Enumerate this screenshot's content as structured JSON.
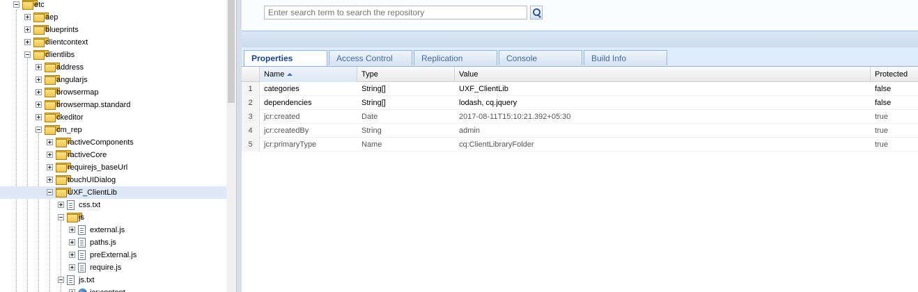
{
  "tree": {
    "items": [
      {
        "label": "etc",
        "type": "folder",
        "toggle": "minus"
      },
      {
        "label": "aep",
        "type": "folder",
        "toggle": "plus"
      },
      {
        "label": "blueprints",
        "type": "folder",
        "toggle": "plus"
      },
      {
        "label": "clientcontext",
        "type": "folder",
        "toggle": "plus"
      },
      {
        "label": "clientlibs",
        "type": "folder",
        "toggle": "minus"
      },
      {
        "label": "address",
        "type": "folder",
        "toggle": "plus"
      },
      {
        "label": "angularjs",
        "type": "folder",
        "toggle": "plus"
      },
      {
        "label": "browsermap",
        "type": "folder",
        "toggle": "plus"
      },
      {
        "label": "browsermap.standard",
        "type": "folder",
        "toggle": "plus"
      },
      {
        "label": "ckeditor",
        "type": "folder",
        "toggle": "plus"
      },
      {
        "label": "cm_rep",
        "type": "folder",
        "toggle": "minus"
      },
      {
        "label": "ractiveComponents",
        "type": "folder",
        "toggle": "plus"
      },
      {
        "label": "ractiveCore",
        "type": "folder",
        "toggle": "plus"
      },
      {
        "label": "requirejs_baseUrl",
        "type": "folder",
        "toggle": "plus"
      },
      {
        "label": "touchUIDialog",
        "type": "folder",
        "toggle": "plus"
      },
      {
        "label": "UXF_ClientLib",
        "type": "folder",
        "toggle": "minus",
        "selected": true
      },
      {
        "label": "css.txt",
        "type": "file",
        "toggle": "plus"
      },
      {
        "label": "js",
        "type": "folder",
        "toggle": "minus"
      },
      {
        "label": "external.js",
        "type": "file",
        "toggle": "plus"
      },
      {
        "label": "paths.js",
        "type": "file",
        "toggle": "plus"
      },
      {
        "label": "preExternal.js",
        "type": "file",
        "toggle": "plus"
      },
      {
        "label": "require.js",
        "type": "file",
        "toggle": "plus"
      },
      {
        "label": "js.txt",
        "type": "file",
        "toggle": "minus"
      },
      {
        "label": "jcr:content",
        "type": "node",
        "toggle": "plus"
      }
    ]
  },
  "search": {
    "placeholder": "Enter search term to search the repository"
  },
  "tabs": [
    {
      "label": "Properties",
      "active": true
    },
    {
      "label": "Access Control",
      "active": false
    },
    {
      "label": "Replication",
      "active": false
    },
    {
      "label": "Console",
      "active": false
    },
    {
      "label": "Build Info",
      "active": false
    }
  ],
  "grid": {
    "columns": [
      "Name",
      "Type",
      "Value",
      "Protected"
    ],
    "sorted_column": "Name",
    "rows": [
      {
        "num": "1",
        "name": "categories",
        "type": "String[]",
        "value": "UXF_ClientLib",
        "protected": "false"
      },
      {
        "num": "2",
        "name": "dependencies",
        "type": "String[]",
        "value": "lodash, cq.jquery",
        "protected": "false"
      },
      {
        "num": "3",
        "name": "jcr:created",
        "type": "Date",
        "value": "2017-08-11T15:10:21.392+05:30",
        "protected": "true"
      },
      {
        "num": "4",
        "name": "jcr:createdBy",
        "type": "String",
        "value": "admin",
        "protected": "true"
      },
      {
        "num": "5",
        "name": "jcr:primaryType",
        "type": "Name",
        "value": "cq:ClientLibraryFolder",
        "protected": "true"
      }
    ]
  },
  "colors": {
    "selected_row": "#dfe8f6",
    "tab_text": "#15428b",
    "tab_border": "#8db2e3"
  }
}
